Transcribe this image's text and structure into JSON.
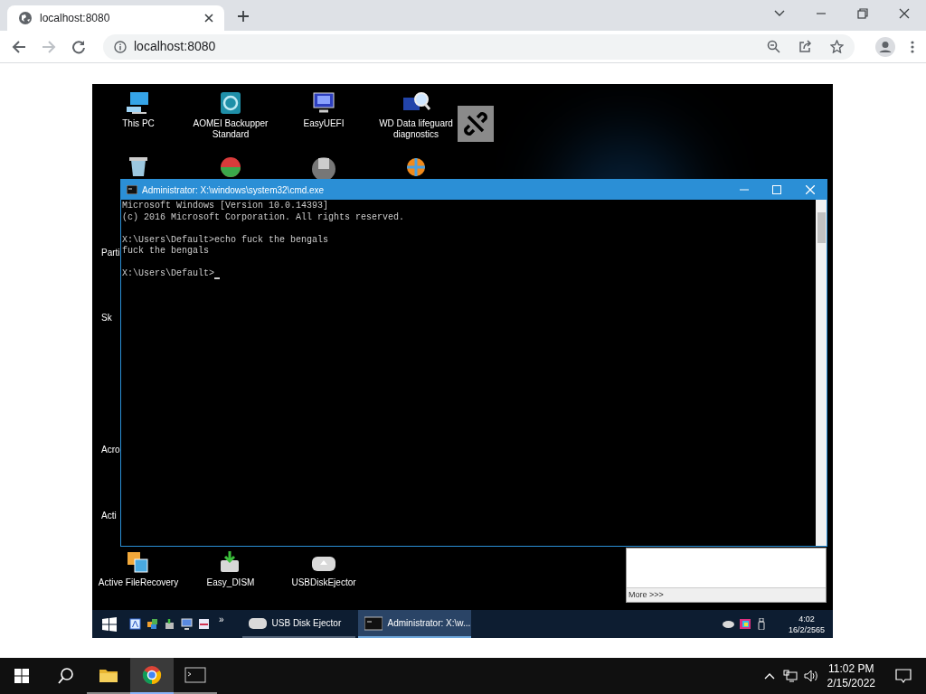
{
  "browser": {
    "tab": {
      "title": "localhost:8080",
      "selected": true
    },
    "url": "localhost:8080"
  },
  "remote_desktop": {
    "desktop_icons": [
      {
        "kind": "pc",
        "label": "This PC"
      },
      {
        "kind": "backup",
        "label": "AOMEI Backupper Standard"
      },
      {
        "kind": "uefi",
        "label": "EasyUEFI"
      },
      {
        "kind": "wd",
        "label": "WD Data lifeguard diagnostics"
      },
      {
        "kind": "recovery",
        "label": "Active FileRecovery"
      },
      {
        "kind": "dism",
        "label": "Easy_DISM"
      },
      {
        "kind": "ejector",
        "label": "USBDiskEjector"
      }
    ],
    "partial_labels": [
      "Parti",
      "Sk",
      "Acro",
      "Acti"
    ],
    "cmd_window": {
      "title": "Administrator: X:\\windows\\system32\\cmd.exe",
      "blocks": [
        [
          "Microsoft Windows [Version 10.0.14393]",
          "(c) 2016 Microsoft Corporation. All rights reserved."
        ],
        [
          "X:\\Users\\Default>echo fuck the bengals",
          "fuck the bengals"
        ],
        [
          "X:\\Users\\Default>"
        ]
      ]
    },
    "popup": {
      "link": "More >>>"
    },
    "taskbar": {
      "overflow": "»",
      "tasks": [
        {
          "kind": "usb",
          "label": "USB Disk Ejector",
          "selected": false
        },
        {
          "kind": "cmd",
          "label": "Administrator: X:\\w...",
          "selected": true
        }
      ],
      "clock": {
        "time": "4:02",
        "date": "16/2/2565"
      }
    }
  },
  "taskbar": {
    "apps": [
      {
        "kind": "explorer",
        "selected": false
      },
      {
        "kind": "chrome",
        "selected": true
      },
      {
        "kind": "cmd",
        "selected": false
      }
    ],
    "clock": {
      "time": "11:02 PM",
      "date": "2/15/2022"
    }
  }
}
